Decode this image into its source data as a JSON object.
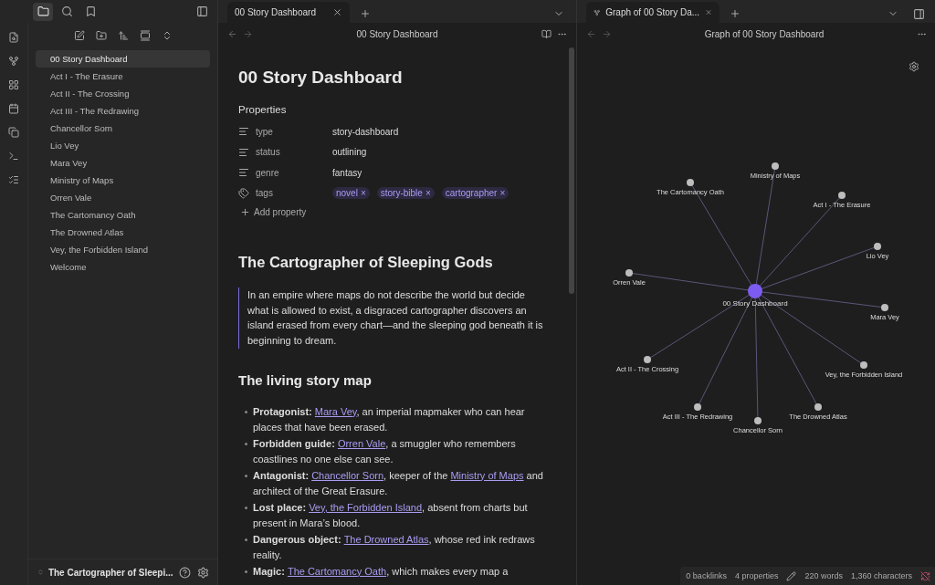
{
  "left_tabs": [
    {
      "kind": "files",
      "selected": true
    },
    {
      "kind": "search",
      "selected": false
    },
    {
      "kind": "bookmarks",
      "selected": false
    }
  ],
  "sidebar": {
    "items": [
      {
        "label": "00 Story Dashboard",
        "selected": true
      },
      {
        "label": "Act I - The Erasure",
        "selected": false
      },
      {
        "label": "Act II - The Crossing",
        "selected": false
      },
      {
        "label": "Act III - The Redrawing",
        "selected": false
      },
      {
        "label": "Chancellor Sorn",
        "selected": false
      },
      {
        "label": "Lio Vey",
        "selected": false
      },
      {
        "label": "Mara Vey",
        "selected": false
      },
      {
        "label": "Ministry of Maps",
        "selected": false
      },
      {
        "label": "Orren Vale",
        "selected": false
      },
      {
        "label": "The Cartomancy Oath",
        "selected": false
      },
      {
        "label": "The Drowned Atlas",
        "selected": false
      },
      {
        "label": "Vey, the Forbidden Island",
        "selected": false
      },
      {
        "label": "Welcome",
        "selected": false
      }
    ],
    "vault_name": "The Cartographer of Sleepi..."
  },
  "editor": {
    "tab": "00 Story Dashboard",
    "view_title": "00 Story Dashboard",
    "title": "00 Story Dashboard",
    "properties_heading": "Properties",
    "properties": [
      {
        "kind": "text",
        "name": "type",
        "value": "story-dashboard"
      },
      {
        "kind": "text",
        "name": "status",
        "value": "outlining"
      },
      {
        "kind": "text",
        "name": "genre",
        "value": "fantasy"
      },
      {
        "kind": "tags",
        "name": "tags",
        "tags": [
          {
            "label": "novel",
            "remove": "×"
          },
          {
            "label": "story-bible",
            "remove": "×"
          },
          {
            "label": "cartographer",
            "remove": "×"
          }
        ]
      }
    ],
    "add_property": "Add property",
    "heading": "The Cartographer of Sleeping Gods",
    "blockquote": "In an empire where maps do not describe the world but decide what is allowed to exist, a disgraced cartographer discovers an island erased from every chart—and the sleeping god beneath it is beginning to dream.",
    "subheading": "The living story map",
    "bullets": [
      [
        {
          "kind": "bold",
          "text": "Protagonist: "
        },
        {
          "kind": "link",
          "text": "Mara Vey"
        },
        {
          "kind": "text",
          "text": ", an imperial mapmaker who can hear places that have been erased."
        }
      ],
      [
        {
          "kind": "bold",
          "text": "Forbidden guide: "
        },
        {
          "kind": "link",
          "text": "Orren Vale"
        },
        {
          "kind": "text",
          "text": ", a smuggler who remembers coastlines no one else can see."
        }
      ],
      [
        {
          "kind": "bold",
          "text": "Antagonist: "
        },
        {
          "kind": "link",
          "text": "Chancellor Sorn"
        },
        {
          "kind": "text",
          "text": ", keeper of the "
        },
        {
          "kind": "link",
          "text": "Ministry of Maps"
        },
        {
          "kind": "text",
          "text": " and architect of the Great Erasure."
        }
      ],
      [
        {
          "kind": "bold",
          "text": "Lost place: "
        },
        {
          "kind": "link",
          "text": "Vey, the Forbidden Island"
        },
        {
          "kind": "text",
          "text": ", absent from charts but present in Mara’s blood."
        }
      ],
      [
        {
          "kind": "bold",
          "text": "Dangerous object: "
        },
        {
          "kind": "link",
          "text": "The Drowned Atlas"
        },
        {
          "kind": "text",
          "text": ", whose red ink redraws reality."
        }
      ],
      [
        {
          "kind": "bold",
          "text": "Magic: "
        },
        {
          "kind": "link",
          "text": "The Cartomancy Oath"
        },
        {
          "kind": "text",
          "text": ", which makes every map a"
        }
      ]
    ]
  },
  "graph": {
    "tab": "Graph of 00 Story Da...",
    "view_title": "Graph of 00 Story Dashboard",
    "center": "00 Story Dashboard",
    "nodes": [
      "Ministry of Maps",
      "The Cartomancy Oath",
      "Act I - The Erasure",
      "Lio Vey",
      "Orren Vale",
      "Mara Vey",
      "Act II - The Crossing",
      "Vey, the Forbidden Island",
      "Act III - The Redrawing",
      "Chancellor Sorn",
      "The Drowned Atlas"
    ]
  },
  "status_bar": {
    "backlinks": "0 backlinks",
    "properties": "4 properties",
    "words": "220 words",
    "characters": "1,360 characters"
  }
}
